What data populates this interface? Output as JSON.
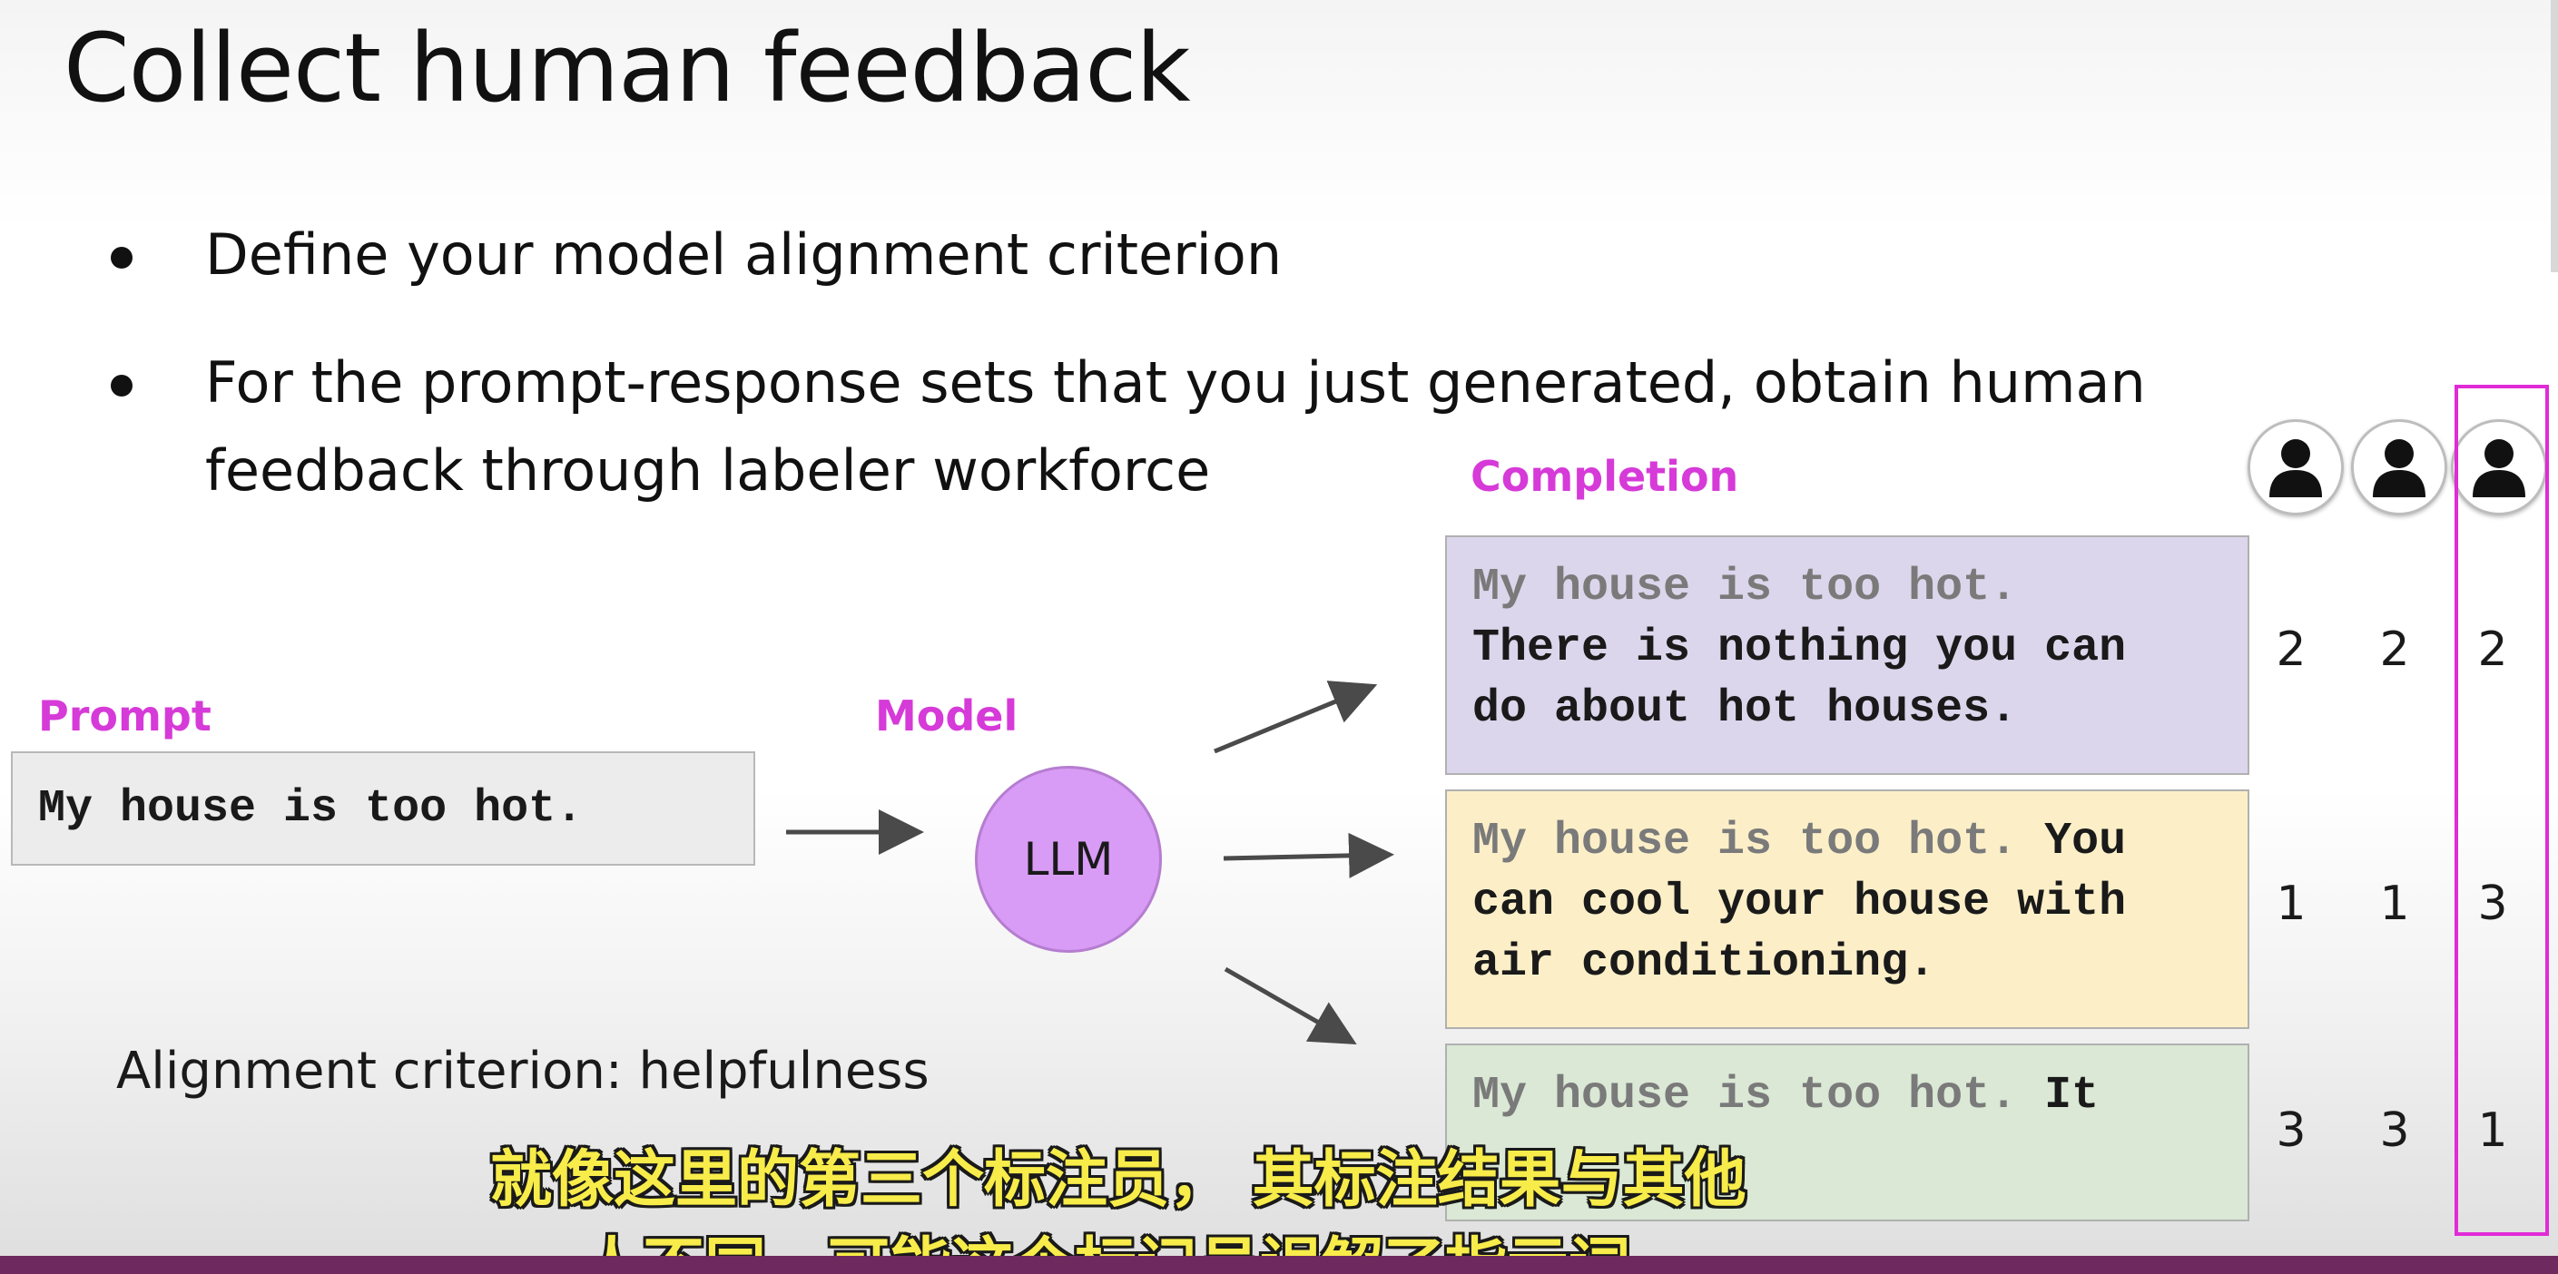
{
  "slide": {
    "title": "Collect human feedback",
    "bullets": [
      "Define your model alignment criterion",
      "For the prompt-response sets that you just generated, obtain human",
      "feedback through labeler workforce"
    ],
    "labels": {
      "prompt": "Prompt",
      "model": "Model",
      "completion": "Completion"
    },
    "prompt_text": "My house is too hot.",
    "model_name": "LLM",
    "completions": [
      {
        "lines": [
          {
            "gray": "My house is too hot.",
            "dark": ""
          },
          {
            "gray": "",
            "dark": "There is nothing you can"
          },
          {
            "gray": "",
            "dark": "do about hot houses."
          }
        ],
        "color": "#dcd6ec"
      },
      {
        "lines": [
          {
            "gray": "My house is too hot.",
            "dark": " You"
          },
          {
            "gray": "",
            "dark": "can cool your house with"
          },
          {
            "gray": "",
            "dark": "air conditioning."
          }
        ],
        "color": "#fcefc8"
      },
      {
        "lines": [
          {
            "gray": "My house is too hot.",
            "dark": " It"
          }
        ],
        "color": "#dae8d5"
      }
    ],
    "ratings": [
      [
        "2",
        "2",
        "2"
      ],
      [
        "1",
        "1",
        "3"
      ],
      [
        "3",
        "3",
        "1"
      ]
    ],
    "labeler_icons": [
      "person-icon",
      "person-icon",
      "person-icon"
    ],
    "criterion": "Alignment criterion: helpfulness",
    "accent_color": "#d63ad8",
    "highlight_color": "#e02bd6"
  },
  "subtitles": {
    "line1": "就像这里的第三个标注员， 其标注结果与其他",
    "line2": "人不同，可能这个标记员误解了指示词"
  }
}
